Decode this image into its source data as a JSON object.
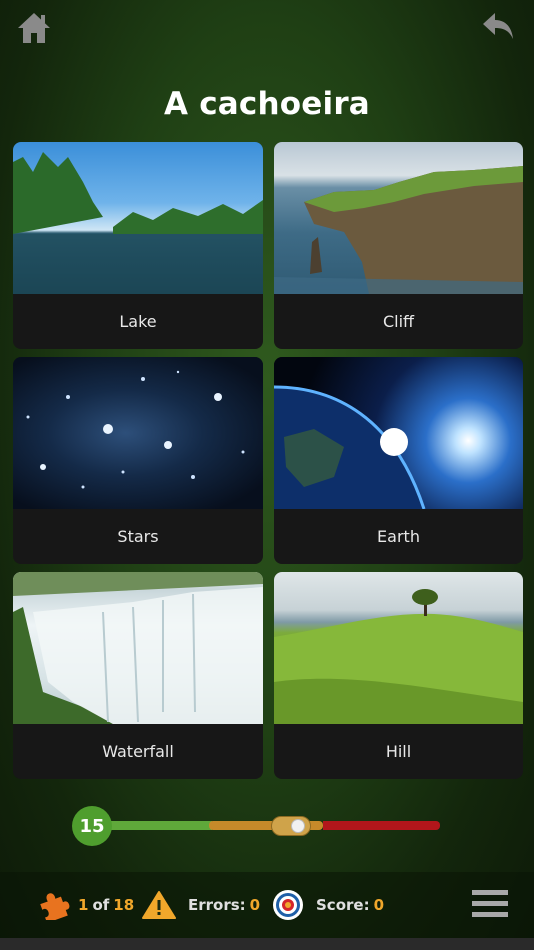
{
  "topbar": {
    "home_icon": "home-icon",
    "back_icon": "undo-arrow-icon"
  },
  "title": "A cachoeira",
  "cards": [
    {
      "label": "Lake",
      "image": "lake"
    },
    {
      "label": "Cliff",
      "image": "cliff"
    },
    {
      "label": "Stars",
      "image": "stars"
    },
    {
      "label": "Earth",
      "image": "earth"
    },
    {
      "label": "Waterfall",
      "image": "waterfall"
    },
    {
      "label": "Hill",
      "image": "hill"
    }
  ],
  "timer": {
    "value": "15",
    "position_fraction": 0.56
  },
  "status": {
    "progress_current": "1",
    "progress_of": "of",
    "progress_total": "18",
    "errors_label": "Errors:",
    "errors_value": "0",
    "score_label": "Score:",
    "score_value": "0"
  },
  "colors": {
    "accent_orange": "#f0a72b",
    "timer_green": "#4f9e2e",
    "bar_green": "#5fa83a",
    "bar_orange": "#c58a2a",
    "bar_red": "#b2161b"
  }
}
